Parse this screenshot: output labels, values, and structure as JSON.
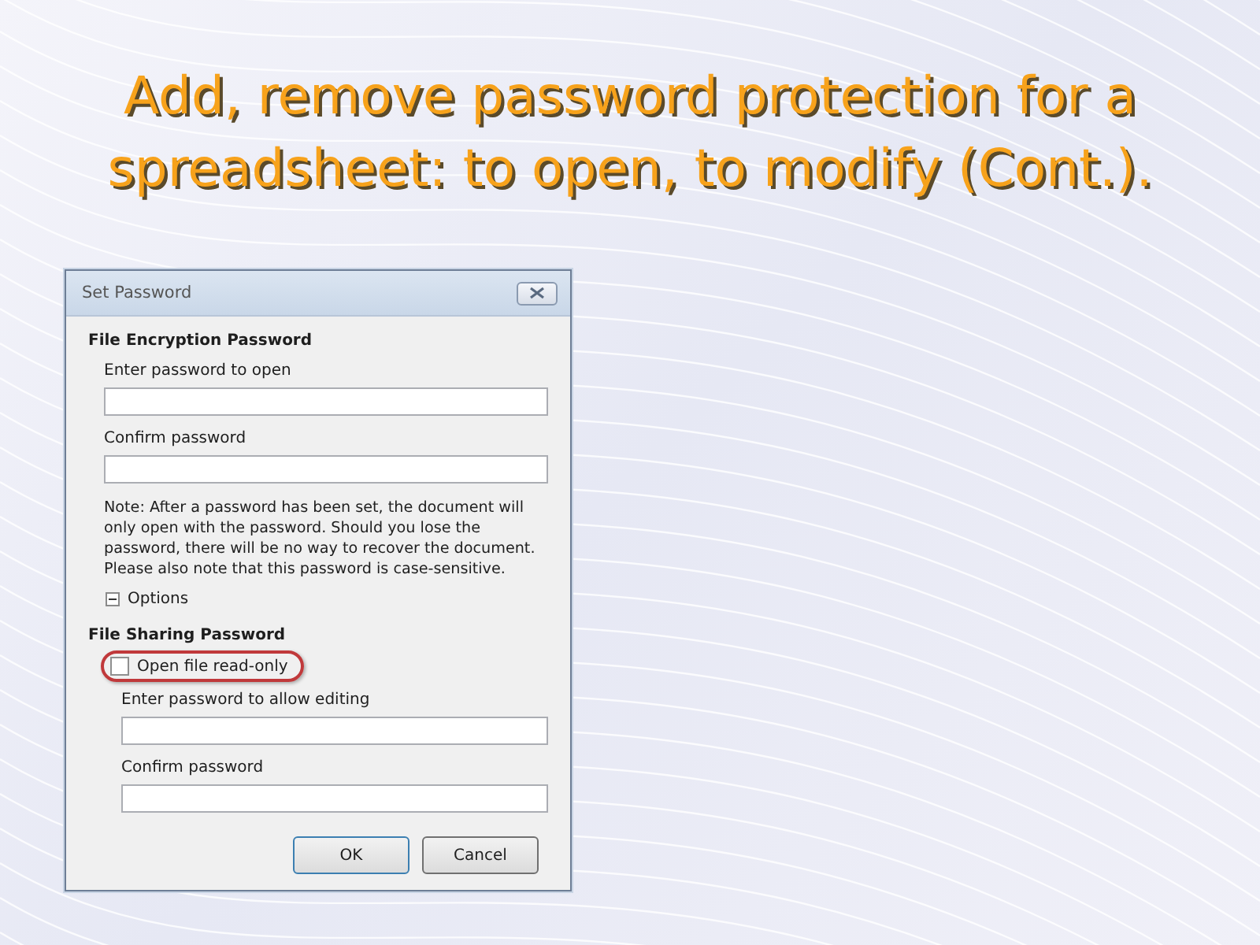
{
  "slide": {
    "title": "Add, remove password protection for a spreadsheet: to open, to modify (Cont.)."
  },
  "dialog": {
    "title": "Set Password",
    "encryption": {
      "heading": "File Encryption Password",
      "fields": [
        {
          "label": "Enter password to open"
        },
        {
          "label": "Confirm password"
        }
      ],
      "note": "Note: After a password has been set, the document will only open with the password. Should you lose the password, there will be no way to recover the document. Please also note that this password is case-sensitive."
    },
    "options": {
      "label": "Options",
      "expanded": true
    },
    "sharing": {
      "heading": "File Sharing Password",
      "read_only": {
        "label": "Open file read-only",
        "checked": false,
        "highlighted": true
      },
      "fields": [
        {
          "label": "Enter password to allow editing"
        },
        {
          "label": "Confirm password"
        }
      ]
    },
    "buttons": [
      {
        "label": "OK",
        "default": true
      },
      {
        "label": "Cancel",
        "default": false
      }
    ]
  }
}
